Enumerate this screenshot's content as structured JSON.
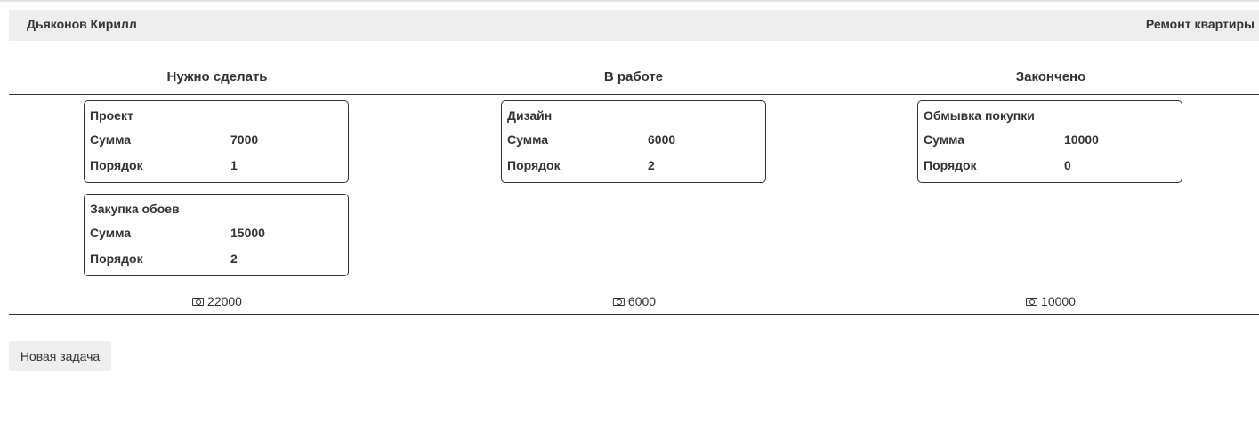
{
  "header": {
    "user_name": "Дьяконов Кирилл",
    "project_name": "Ремонт квартиры"
  },
  "columns": [
    {
      "title": "Нужно сделать",
      "total": "22000",
      "cards": [
        {
          "title": "Проект",
          "sum_label": "Сумма",
          "sum": "7000",
          "order_label": "Порядок",
          "order": "1"
        },
        {
          "title": "Закупка обоев",
          "sum_label": "Сумма",
          "sum": "15000",
          "order_label": "Порядок",
          "order": "2"
        }
      ]
    },
    {
      "title": "В работе",
      "total": "6000",
      "cards": [
        {
          "title": "Дизайн",
          "sum_label": "Сумма",
          "sum": "6000",
          "order_label": "Порядок",
          "order": "2"
        }
      ]
    },
    {
      "title": "Закончено",
      "total": "10000",
      "cards": [
        {
          "title": "Обмывка покупки",
          "sum_label": "Сумма",
          "sum": "10000",
          "order_label": "Порядок",
          "order": "0"
        }
      ]
    }
  ],
  "actions": {
    "new_task_label": "Новая задача"
  },
  "icons": {
    "total_icon": "money-icon"
  },
  "colors": {
    "header_bg": "#eeeeee",
    "text": "#333333",
    "border": "#333333"
  }
}
